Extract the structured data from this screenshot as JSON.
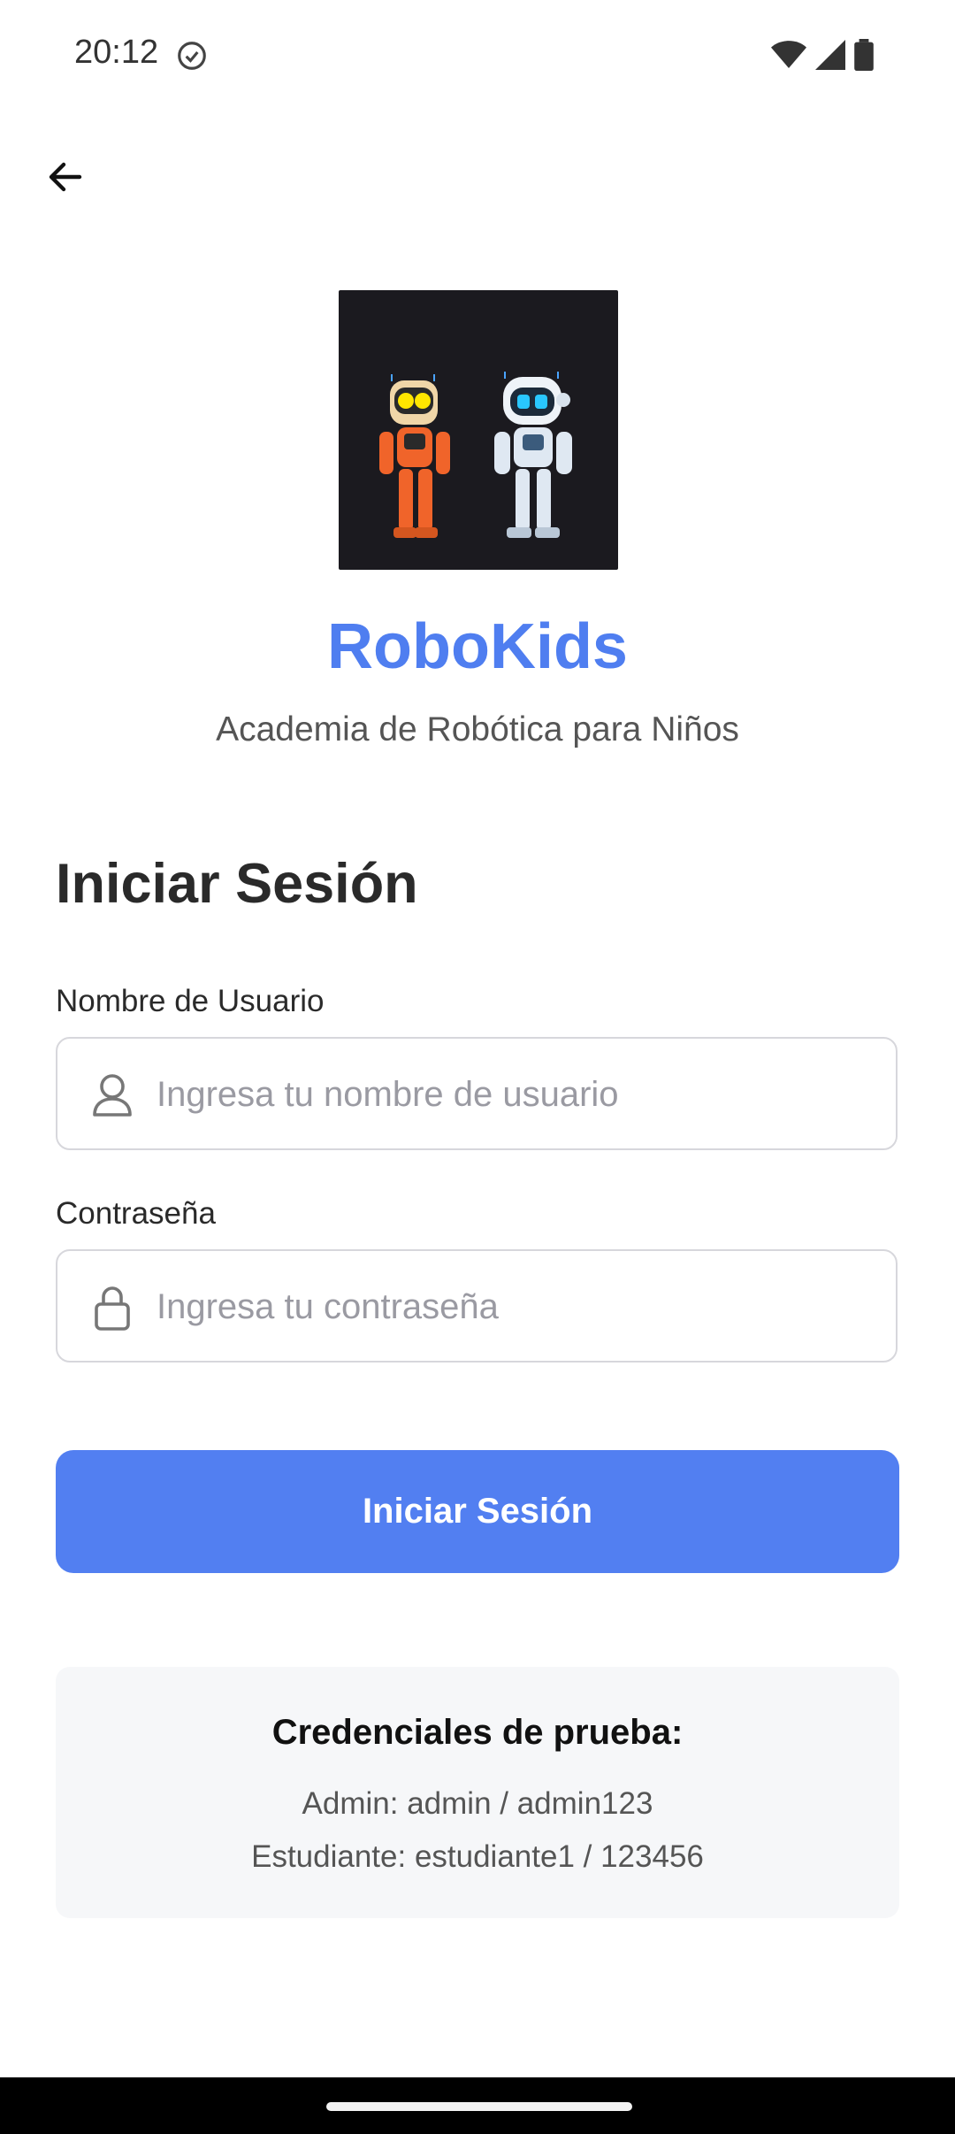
{
  "status": {
    "time": "20:12"
  },
  "brand": {
    "title": "RoboKids",
    "subtitle": "Academia de Robótica para Niños",
    "accent": "#4f7ef0"
  },
  "login": {
    "title": "Iniciar Sesión",
    "username_label": "Nombre de Usuario",
    "username_placeholder": "Ingresa tu nombre de usuario",
    "password_label": "Contraseña",
    "password_placeholder": "Ingresa tu contraseña",
    "submit_label": "Iniciar Sesión",
    "button_color": "#527ff1"
  },
  "credentials": {
    "title": "Credenciales de prueba:",
    "admin": "Admin: admin / admin123",
    "student": "Estudiante: estudiante1 / 123456"
  },
  "icons": {
    "back": "arrow-left-icon",
    "user": "user-icon",
    "lock": "lock-icon"
  }
}
